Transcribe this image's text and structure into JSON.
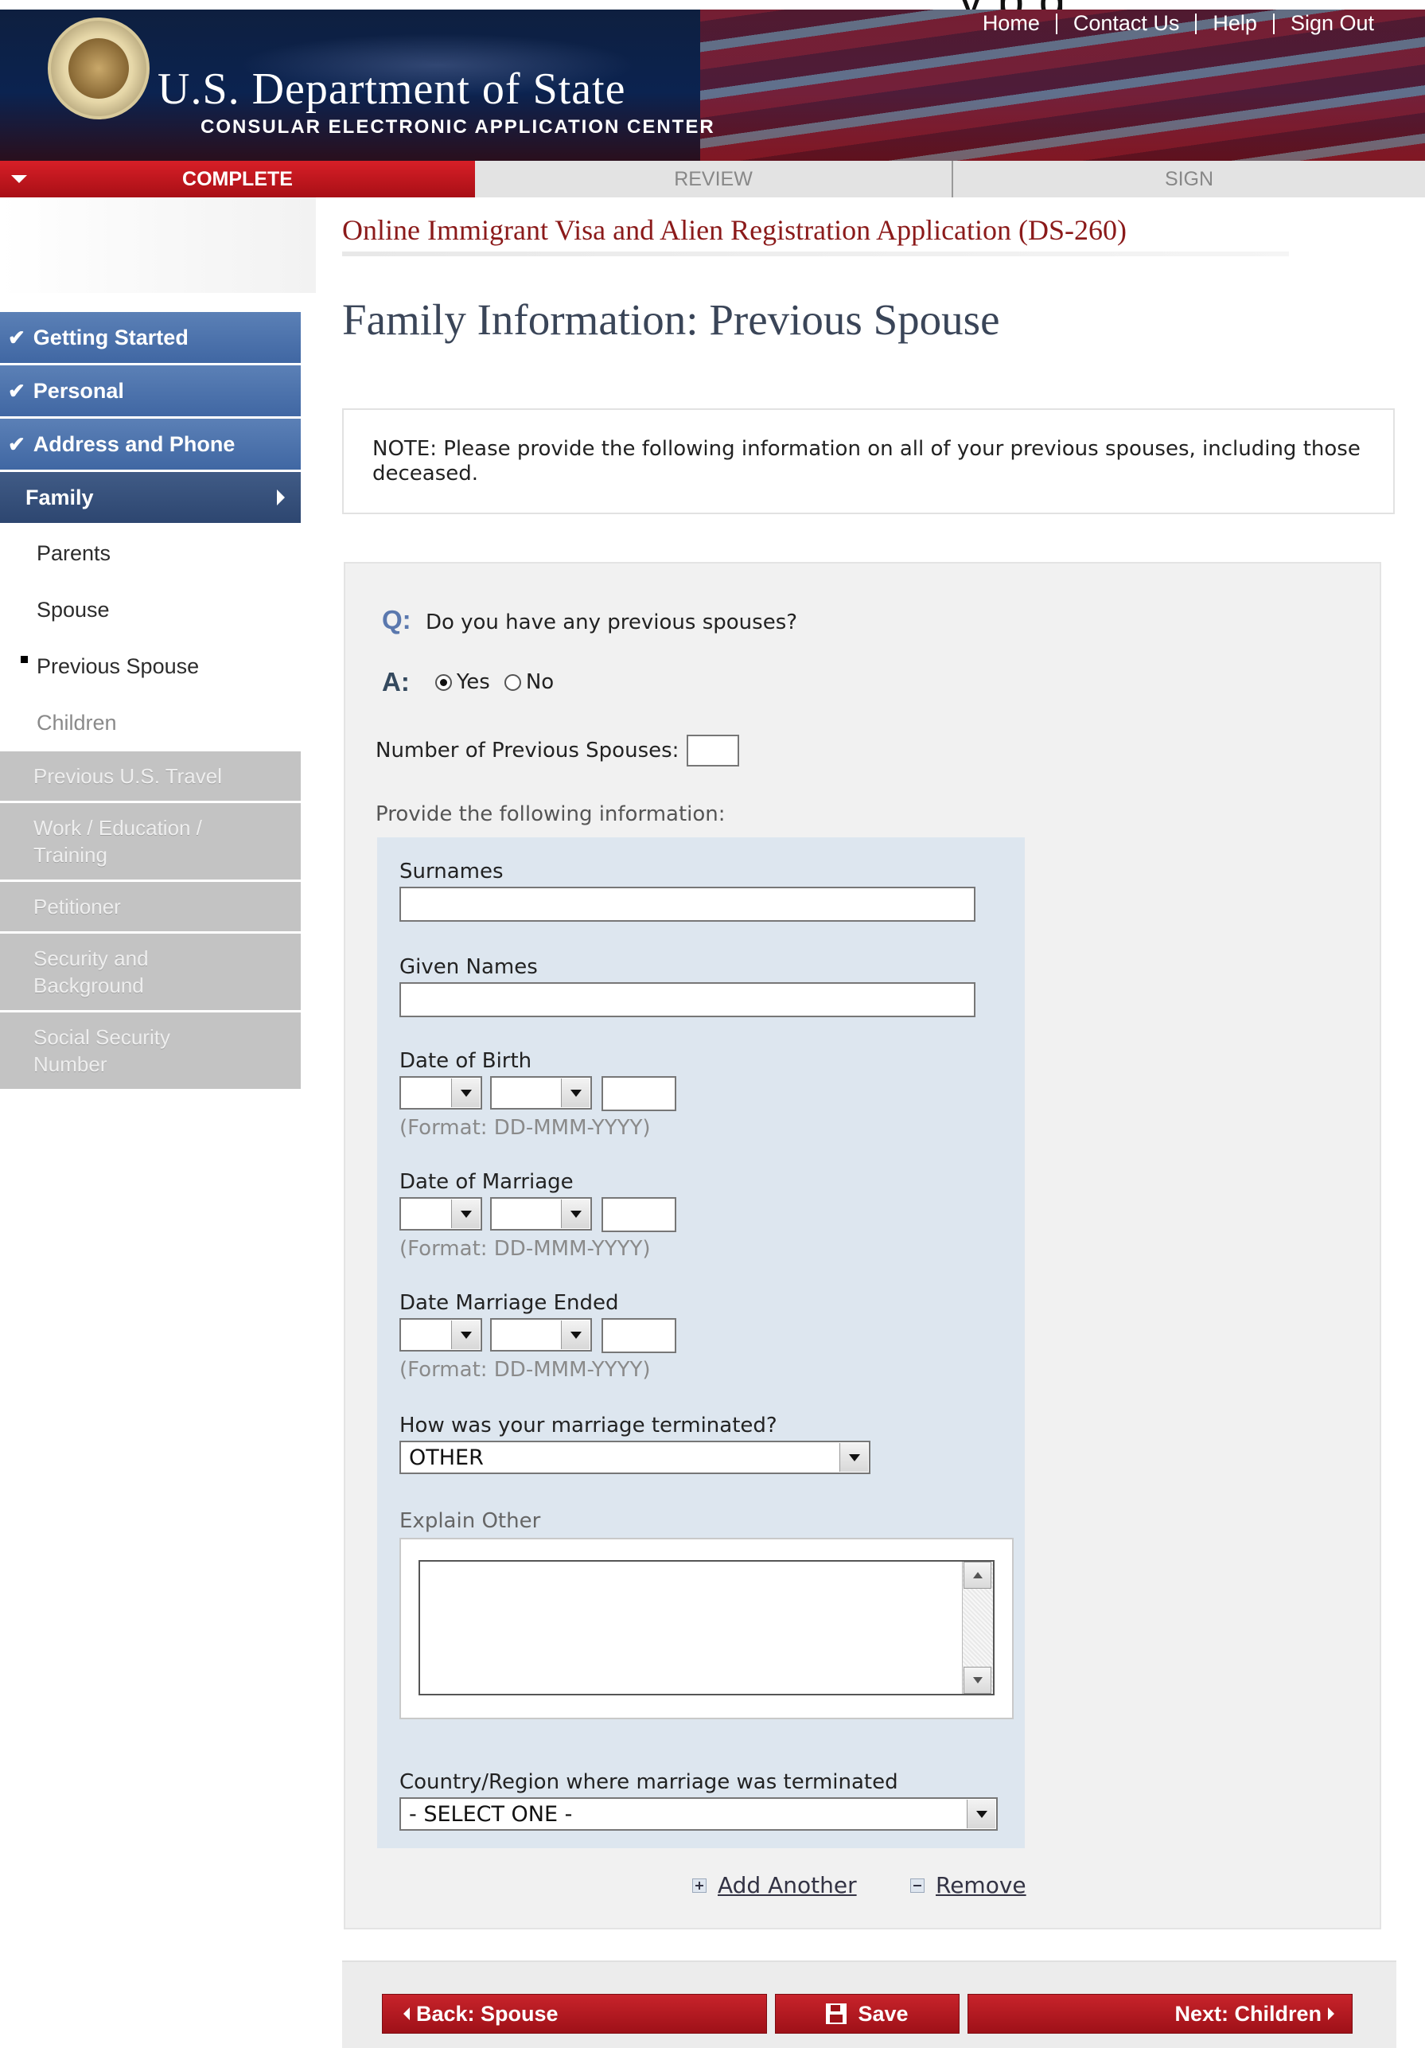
{
  "header": {
    "top_crop_text": "y  p  g",
    "brand_title": "U.S. Department of State",
    "brand_subtitle": "CONSULAR ELECTRONIC APPLICATION CENTER",
    "links": [
      "Home",
      "Contact Us",
      "Help",
      "Sign Out"
    ]
  },
  "progress": {
    "steps": [
      "COMPLETE",
      "REVIEW",
      "SIGN"
    ],
    "active": "COMPLETE"
  },
  "app_title": "Online Immigrant Visa and Alien Registration Application (DS-260)",
  "page_title": "Family Information: Previous Spouse",
  "sidebar": {
    "done": [
      "Getting Started",
      "Personal",
      "Address and Phone"
    ],
    "active": "Family",
    "sub": [
      "Parents",
      "Spouse",
      "Previous Spouse",
      "Children"
    ],
    "current_sub": "Previous Spouse",
    "locked": [
      "Previous U.S. Travel",
      "Work / Education / Training",
      "Petitioner",
      "Security and Background",
      "Social Security Number"
    ]
  },
  "note": "NOTE: Please provide the following information on all of your previous spouses, including those deceased.",
  "question": {
    "q_tag": "Q:",
    "a_tag": "A:",
    "text": "Do you have any previous spouses?",
    "options": [
      "Yes",
      "No"
    ],
    "selected": "Yes",
    "count_label": "Number of Previous Spouses:",
    "count_value": "",
    "provide_label": "Provide the following information:"
  },
  "form": {
    "surnames_label": "Surnames",
    "surnames_value": "",
    "given_names_label": "Given Names",
    "given_names_value": "",
    "dob_label": "Date of Birth",
    "dom_label": "Date of Marriage",
    "dme_label": "Date Marriage Ended",
    "date_format": "(Format: DD-MMM-YYYY)",
    "termination_label": "How was your marriage terminated?",
    "termination_value": "OTHER",
    "explain_label": "Explain Other",
    "explain_value": "",
    "country_label": "Country/Region where marriage was terminated",
    "country_value": "- SELECT ONE -"
  },
  "actions": {
    "add": "Add Another",
    "remove": "Remove"
  },
  "buttons": {
    "back": "Back: Spouse",
    "save": "Save",
    "next": "Next: Children"
  },
  "colors": {
    "brand_red": "#b3141c",
    "nav_blue": "#4a6fa9",
    "nav_active": "#34507d",
    "locked_gray": "#c3c3c3",
    "title_maroon": "#8b1a1a"
  }
}
